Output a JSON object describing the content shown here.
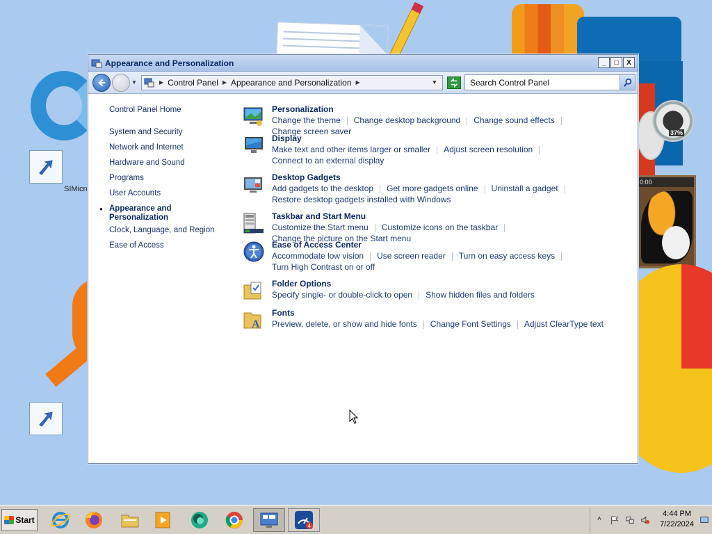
{
  "window": {
    "title": "Appearance and Personalization",
    "controls": {
      "minimize": "_",
      "maximize": "□",
      "close": "X"
    }
  },
  "navbar": {
    "breadcrumb": [
      "Control Panel",
      "Appearance and Personalization"
    ],
    "search_placeholder": "Search Control Panel"
  },
  "sidebar": {
    "home": "Control Panel Home",
    "items": [
      "System and Security",
      "Network and Internet",
      "Hardware and Sound",
      "Programs",
      "User Accounts",
      "Appearance and Personalization",
      "Clock, Language, and Region",
      "Ease of Access"
    ],
    "current": "Appearance and Personalization"
  },
  "categories": [
    {
      "title": "Personalization",
      "icon": "personalization-icon",
      "links": [
        "Change the theme",
        "Change desktop background",
        "Change sound effects",
        "Change screen saver"
      ]
    },
    {
      "title": "Display",
      "icon": "display-icon",
      "links": [
        "Make text and other items larger or smaller",
        "Adjust screen resolution",
        "Connect to an external display"
      ]
    },
    {
      "title": "Desktop Gadgets",
      "icon": "gadgets-icon",
      "links": [
        "Add gadgets to the desktop",
        "Get more gadgets online",
        "Uninstall a gadget",
        "Restore desktop gadgets installed with Windows"
      ]
    },
    {
      "title": "Taskbar and Start Menu",
      "icon": "taskbar-icon",
      "links": [
        "Customize the Start menu",
        "Customize icons on the taskbar",
        "Change the picture on the Start menu"
      ]
    },
    {
      "title": "Ease of Access Center",
      "icon": "ease-of-access-icon",
      "links": [
        "Accommodate low vision",
        "Use screen reader",
        "Turn on easy access keys",
        "Turn High Contrast on or off"
      ]
    },
    {
      "title": "Folder Options",
      "icon": "folder-options-icon",
      "links": [
        "Specify single- or double-click to open",
        "Show hidden files and folders"
      ]
    },
    {
      "title": "Fonts",
      "icon": "fonts-icon",
      "links": [
        "Preview, delete, or show and hide fonts",
        "Change Font Settings",
        "Adjust ClearType text"
      ]
    }
  ],
  "desktop": {
    "icon_label": "SIMicro",
    "gadget_photo_time": "0:00",
    "gadget_gauge_value": "37%"
  },
  "taskbar": {
    "start_label": "Start",
    "apps": [
      "internet-explorer-icon",
      "firefox-icon",
      "file-explorer-icon",
      "media-player-icon",
      "messenger-icon",
      "chrome-icon",
      "control-panel-icon",
      "speed-icon"
    ],
    "speed_badge": "4",
    "clock_time": "4:44 PM",
    "clock_date": "7/22/2024"
  },
  "colors": {
    "accent": "#0b2a66",
    "link": "#1a3a7a",
    "desktop": "#abcaf0"
  }
}
